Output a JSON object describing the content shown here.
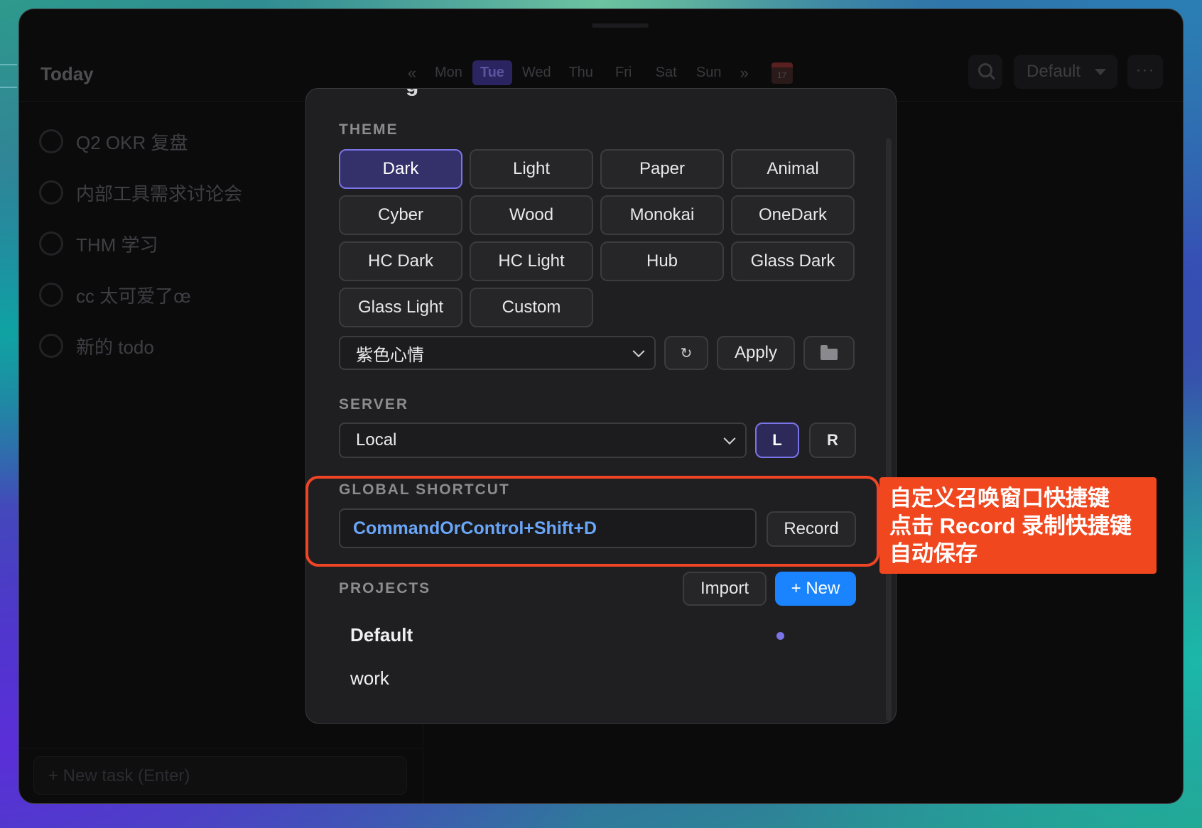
{
  "window": {
    "title": "Today",
    "week_nav": {
      "prev": "«",
      "next": "»",
      "days": [
        "Mon",
        "Tue",
        "Wed",
        "Thu",
        "Fri",
        "Sat",
        "Sun"
      ],
      "selected_day": "Tue",
      "calendar_icon_text": "17"
    },
    "header": {
      "search_icon": "search-icon",
      "project_selector": "Default",
      "more": "···"
    },
    "tasks": [
      "Q2 OKR 复盘",
      "内部工具需求讨论会",
      "THM 学习",
      "cc 太可爱了œ",
      "新的 todo"
    ],
    "new_task_placeholder": "+ New task (Enter)"
  },
  "settings": {
    "title_sliver": "g",
    "theme": {
      "title": "THEME",
      "options": [
        "Dark",
        "Light",
        "Paper",
        "Animal",
        "Cyber",
        "Wood",
        "Monokai",
        "OneDark",
        "HC Dark",
        "HC Light",
        "Hub",
        "Glass Dark",
        "Glass Light",
        "Custom"
      ],
      "selected": "Dark",
      "custom_select_value": "紫色心情",
      "refresh_label": "↻",
      "apply_label": "Apply",
      "folder_icon": "folder-icon"
    },
    "server": {
      "title": "SERVER",
      "select_value": "Local",
      "local_label": "L",
      "remote_label": "R",
      "selected": "L"
    },
    "global_shortcut": {
      "title": "GLOBAL SHORTCUT",
      "value": "CommandOrControl+Shift+D",
      "record_label": "Record"
    },
    "projects": {
      "title": "PROJECTS",
      "import_label": "Import",
      "new_label": "+ New",
      "items": [
        "Default",
        "work"
      ],
      "active": "Default"
    }
  },
  "annotation": {
    "lines": [
      "自定义召唤窗口快捷键",
      "点击 Record 录制快捷键",
      "自动保存"
    ],
    "color": "#f0471f"
  },
  "colors": {
    "accent": "#7b74e8",
    "primary_button": "#1a84ff",
    "shortcut_text": "#6aa6f8"
  }
}
